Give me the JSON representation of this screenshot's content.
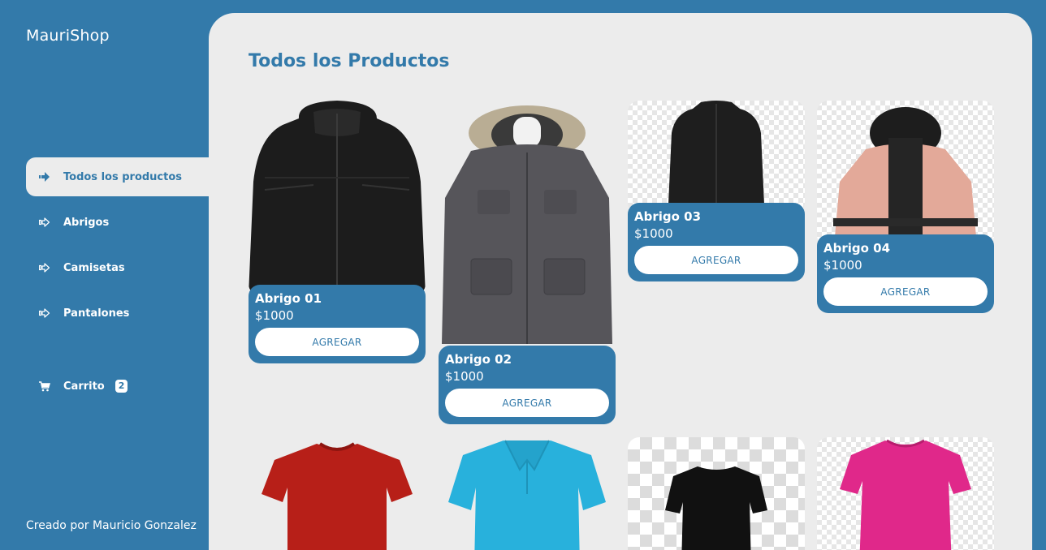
{
  "brand": "MauriShop",
  "nav": {
    "items": [
      {
        "label": "Todos los productos",
        "icon": "arrow-right-icon"
      },
      {
        "label": "Abrigos",
        "icon": "arrow-right-icon"
      },
      {
        "label": "Camisetas",
        "icon": "arrow-right-icon"
      },
      {
        "label": "Pantalones",
        "icon": "arrow-right-icon"
      }
    ],
    "cart": {
      "label": "Carrito",
      "count": "2",
      "icon": "cart-icon"
    }
  },
  "footer": "Creado por Mauricio Gonzalez",
  "main": {
    "title": "Todos los Productos",
    "products": [
      {
        "name": "Abrigo 01",
        "price": "$1000",
        "button": "AGREGAR"
      },
      {
        "name": "Abrigo 02",
        "price": "$1000",
        "button": "AGREGAR"
      },
      {
        "name": "Abrigo 03",
        "price": "$1000",
        "button": "AGREGAR"
      },
      {
        "name": "Abrigo 04",
        "price": "$1000",
        "button": "AGREGAR"
      }
    ]
  },
  "colors": {
    "primary": "#337aaa",
    "panel": "#ececec"
  }
}
